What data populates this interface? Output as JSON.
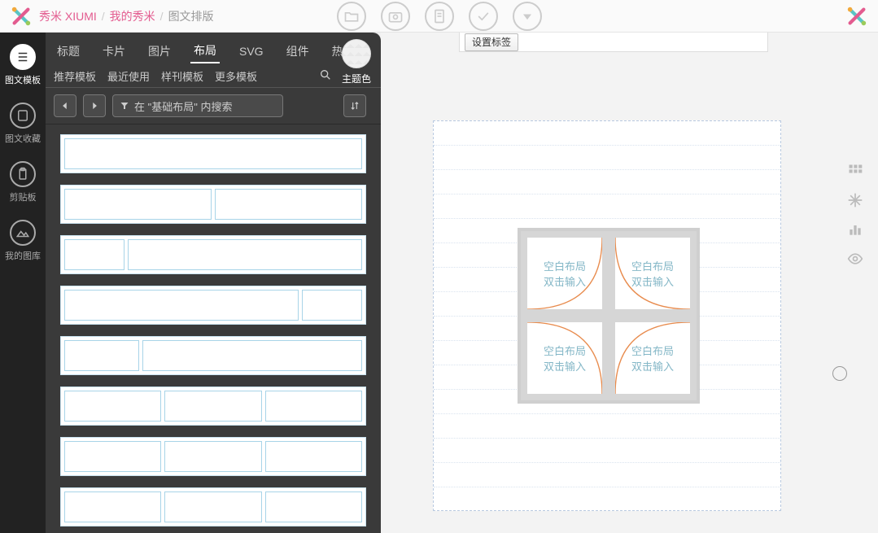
{
  "header": {
    "brand": "秀米 XIUMI",
    "crumb2": "我的秀米",
    "crumb3": "图文排版"
  },
  "leftnav": {
    "items": [
      {
        "label": "图文模板"
      },
      {
        "label": "图文收藏"
      },
      {
        "label": "剪贴板"
      },
      {
        "label": "我的图库"
      }
    ]
  },
  "panel": {
    "tabs": [
      "标题",
      "卡片",
      "图片",
      "布局",
      "SVG",
      "组件",
      "热门"
    ],
    "active_tab": 3,
    "subtabs": [
      "推荐模板",
      "最近使用",
      "样刊模板",
      "更多模板"
    ],
    "search_text": "在 \"基础布局\" 内搜索",
    "theme_label": "主题色"
  },
  "canvas": {
    "set_label_btn": "设置标签",
    "cell_line1": "空白布局",
    "cell_line2": "双击输入"
  }
}
